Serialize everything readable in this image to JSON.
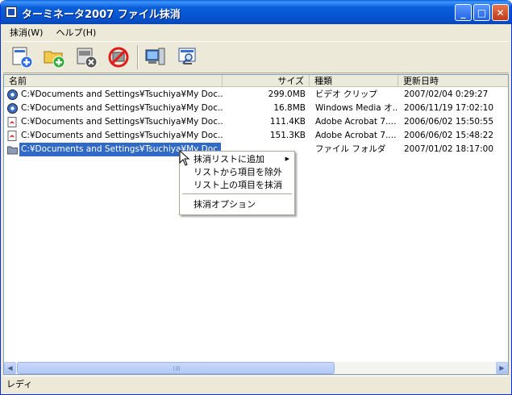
{
  "window": {
    "title": "ターミネータ2007 ファイル抹消"
  },
  "title_buttons": {
    "minimize": "_",
    "maximize": "□",
    "close": "✕"
  },
  "menu": [
    {
      "label": "抹消(W)"
    },
    {
      "label": "ヘルプ(H)"
    }
  ],
  "toolbar": {
    "buttons": [
      {
        "icon": "add-file-icon"
      },
      {
        "icon": "add-folder-icon"
      },
      {
        "icon": "remove-item-icon"
      },
      {
        "icon": "no-erase-icon"
      },
      {
        "icon": "computer-icon"
      },
      {
        "icon": "monitor-search-icon"
      }
    ]
  },
  "columns": [
    {
      "label": "名前"
    },
    {
      "label": "サイズ"
    },
    {
      "label": "種類"
    },
    {
      "label": "更新日時"
    }
  ],
  "rows": [
    {
      "icon": "video-file-icon",
      "name": "C:¥Documents and Settings¥Tsuchiya¥My Doc...",
      "size": "299.0MB",
      "type": "ビデオ クリップ",
      "date": "2007/02/04 0:29:27"
    },
    {
      "icon": "media-file-icon",
      "name": "C:¥Documents and Settings¥Tsuchiya¥My Doc...",
      "size": "16.8MB",
      "type": "Windows Media オ...",
      "date": "2006/11/19 17:02:10"
    },
    {
      "icon": "pdf-file-icon",
      "name": "C:¥Documents and Settings¥Tsuchiya¥My Doc...",
      "size": "111.4KB",
      "type": "Adobe Acrobat 7....",
      "date": "2006/06/02 15:50:55"
    },
    {
      "icon": "pdf-file-icon",
      "name": "C:¥Documents and Settings¥Tsuchiya¥My Doc...",
      "size": "151.3KB",
      "type": "Adobe Acrobat 7....",
      "date": "2006/06/02 15:48:22"
    },
    {
      "icon": "folder-icon",
      "name": "C:¥Documents and Settings¥Tsuchiya¥My Doc...",
      "size": "",
      "type": "ファイル フォルダ",
      "date": "2007/01/02 18:17:00",
      "selected": true
    }
  ],
  "context_menu": {
    "items": [
      {
        "label": "抹消リストに追加",
        "submenu": true
      },
      {
        "label": "リストから項目を除外"
      },
      {
        "label": "リスト上の項目を抹消"
      },
      {
        "label": "抹消オプション"
      }
    ]
  },
  "status": {
    "text": "レディ"
  },
  "colors": {
    "title_blue": "#0554d1",
    "selection": "#316ac5",
    "face": "#ece9d8"
  }
}
